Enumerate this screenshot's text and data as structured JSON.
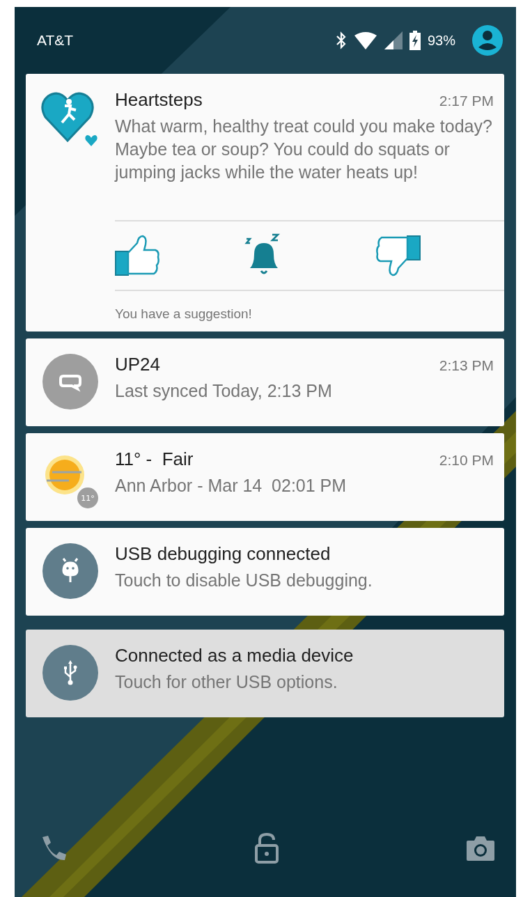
{
  "status_bar": {
    "carrier": "AT&T",
    "battery": "93%"
  },
  "notifications": [
    {
      "kind": "heart",
      "title": "Heartsteps",
      "time": "2:17 PM",
      "text": "What warm, healthy treat could you make today? Maybe tea or soup? You could do squats or jumping jacks while the water heats up!",
      "actions": [
        {
          "kind": "thumbs-up"
        },
        {
          "kind": "snooze"
        },
        {
          "kind": "thumbs-down"
        }
      ],
      "footer": "You have a suggestion!",
      "highlighted": false
    },
    {
      "kind": "band",
      "title": "UP24",
      "time": "2:13 PM",
      "text": "Last synced Today, 2:13 PM",
      "highlighted": false
    },
    {
      "kind": "weather",
      "title": "11° -  Fair",
      "time": "2:10 PM",
      "text": "Ann Arbor - Mar 14  02:01 PM",
      "badge": "11°",
      "highlighted": false
    },
    {
      "kind": "android",
      "title": "USB debugging connected",
      "text": "Touch to disable USB debugging.",
      "highlighted": false
    },
    {
      "kind": "usb",
      "title": "Connected as a media device",
      "text": "Touch for other USB options.",
      "highlighted": true
    }
  ],
  "shortcuts": [
    {
      "kind": "phone"
    },
    {
      "kind": "unlock"
    },
    {
      "kind": "camera"
    }
  ]
}
